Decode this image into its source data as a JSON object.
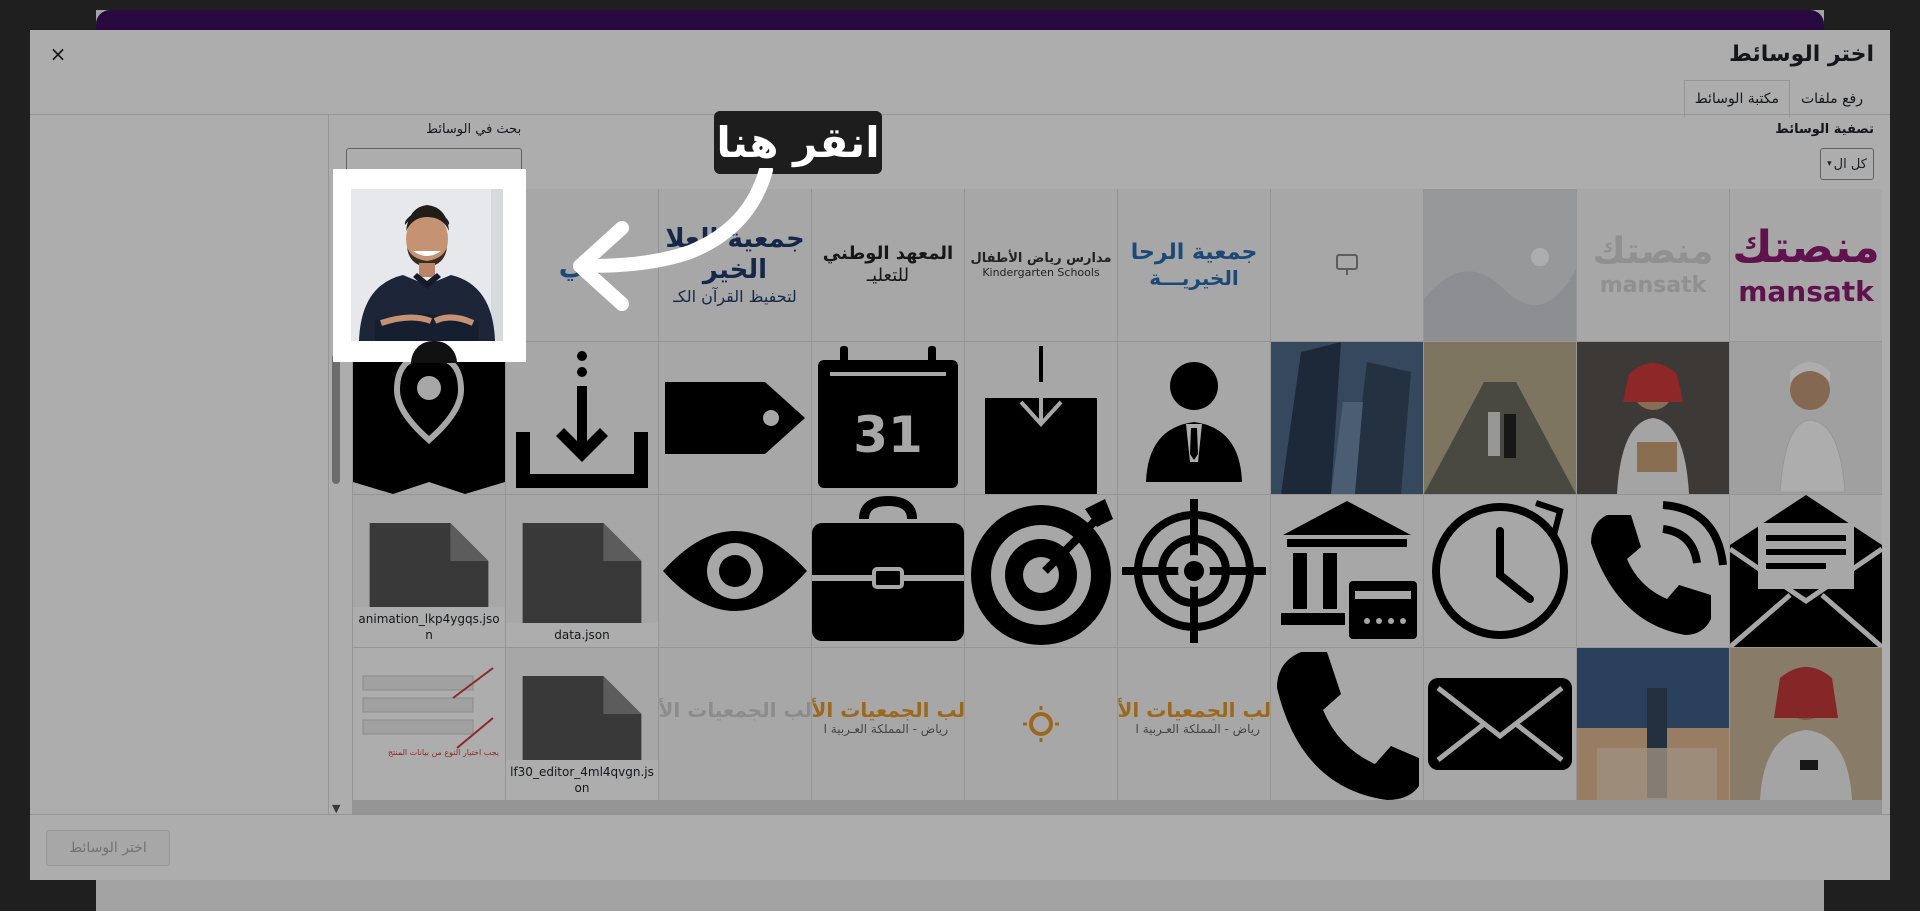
{
  "modal": {
    "title": "اختر الوسائط",
    "close_label": "×",
    "tabs": [
      {
        "label": "رفع ملفات",
        "active": false
      },
      {
        "label": "مكتبة الوسائط",
        "active": true
      }
    ],
    "filter_label": "تصفية الوسائط",
    "filter_value": "كل ال",
    "search_label": "بحث في الوسائط",
    "search_placeholder": "",
    "select_button": "اختر الوسائط"
  },
  "tour": {
    "tooltip_text": "انقر هنا"
  },
  "grid": {
    "row1": [
      {
        "type": "logo",
        "text": "منصتك",
        "subtext": "mansatk",
        "color": "#8e1b73"
      },
      {
        "type": "logo",
        "text": "منصتك",
        "subtext": "mansatk",
        "color": "#c9c9c9"
      },
      {
        "type": "placeholder"
      },
      {
        "type": "screen-icon"
      },
      {
        "type": "logo",
        "text": "جمعية الرحا",
        "subtext": "الخيريـــة",
        "color": "#2a6cb0"
      },
      {
        "type": "logo",
        "text": "مدارس رياض الأطفال",
        "subtext": "Kindergarten Schools",
        "color": "#333"
      },
      {
        "type": "logo",
        "text": "المعهد الوطني",
        "subtext": "للتعليـ",
        "color": "#222"
      },
      {
        "type": "logo",
        "text": "جمعية العلا الخير",
        "subtext": "لتحفيظ القرآن الكـ",
        "color": "#1f3c6d"
      },
      {
        "type": "logo",
        "text": "في",
        "subtext": "",
        "color": "#2a6cb0"
      },
      {
        "type": "spot"
      }
    ],
    "row3_files": [
      {
        "name": "animation_lkp4ygqs.json"
      },
      {
        "name": "data.json"
      }
    ],
    "row4": [
      {
        "type": "photo-city"
      },
      {
        "type": "photo-tower"
      },
      {
        "type": "mail-icon"
      },
      {
        "type": "phone-icon"
      },
      {
        "type": "logo-faded",
        "text": "الب الجمعيات الأ",
        "subtext": "رياض - المملكة العـربية ا"
      },
      {
        "type": "sun-icon"
      },
      {
        "type": "logo-faded",
        "text": "الب الجمعيات الأه",
        "subtext": "رياض - المملكة العـربية ا"
      },
      {
        "type": "logo-faded2",
        "text": "الب الجمعيات الأه",
        "subtext": ""
      },
      {
        "type": "file",
        "name": "lf30_editor_4ml4qvgn.json"
      },
      {
        "type": "screenshot",
        "text": "يجب اختيار النوع من بيانات المنتج"
      }
    ]
  },
  "colors": {
    "accent": "#2271b1",
    "overlay": "rgba(0,0,0,0.32)",
    "brand_purple": "#3a0e5e"
  }
}
